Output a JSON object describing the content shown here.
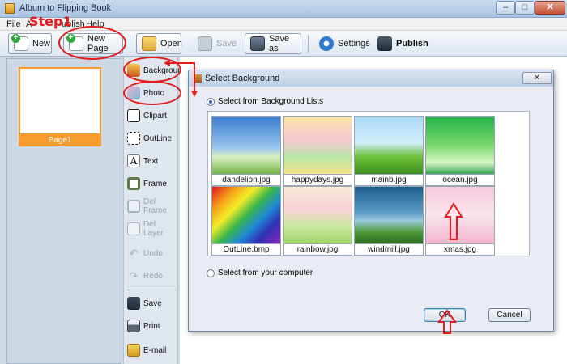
{
  "window": {
    "title": "Album to Flipping Book",
    "min_glyph": "–",
    "max_glyph": "□",
    "close_glyph": "✕"
  },
  "menu": [
    "File",
    "A",
    "ublish",
    "Help"
  ],
  "toolbar": {
    "new_label": "New",
    "new_page_label": "New Page",
    "open_label": "Open",
    "save_label": "Save",
    "save_as_label": "Save as",
    "settings_label": "Settings",
    "publish_label": "Publish"
  },
  "pages": {
    "label": "Page1"
  },
  "tools": {
    "background": "Background",
    "photo": "Photo",
    "clipart": "Clipart",
    "outline": "OutLine",
    "text": "Text",
    "frame": "Frame",
    "del_frame": "Del Frame",
    "del_layer": "Del Layer",
    "undo": "Undo",
    "redo": "Redo",
    "save": "Save",
    "print": "Print",
    "email": "E-mail"
  },
  "dialog": {
    "title": "Select Background",
    "close_glyph": "✕",
    "option_lists": "Select from Background Lists",
    "option_computer": "Select from your computer",
    "ok_label": "OK",
    "cancel_label": "Cancel",
    "backgrounds": [
      "dandelion.jpg",
      "happydays.jpg",
      "mainb.jpg",
      "ocean.jpg",
      "OutLine.bmp",
      "rainbow.jpg",
      "windmill.jpg",
      "xmas.jpg"
    ],
    "selected_option": "lists"
  },
  "annotation": {
    "step_label": "Step1",
    "color": "#e41c1c"
  },
  "colors": {
    "accent_page": "#f59c2c",
    "annotation": "#e41c1c"
  }
}
